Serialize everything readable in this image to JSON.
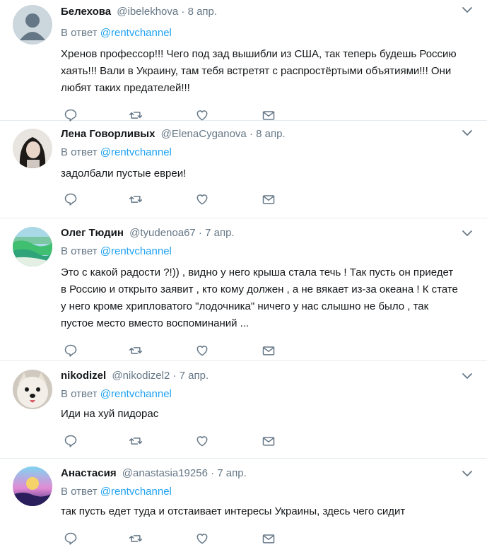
{
  "tweets": [
    {
      "name": "Белехова",
      "handle": "@ibelekhova",
      "time": "8 апр.",
      "reply_prefix": "В ответ ",
      "reply_mention": "@rentvchannel",
      "text": "Хренов профессор!!! Чего под зад вышибли из США, так теперь будешь Россию хаять!!! Вали в Украину, там тебя встретят с распростёртыми объятиями!!! Они любят таких предателей!!!",
      "avatar": "default-avatar"
    },
    {
      "name": "Лена Говорливых",
      "handle": "@ElenaCyganova",
      "time": "8 апр.",
      "reply_prefix": "В ответ ",
      "reply_mention": "@rentvchannel",
      "text": "задолбали пустые евреи!",
      "avatar": "woman-photo-avatar"
    },
    {
      "name": "Олег Тюдин",
      "handle": "@tyudenoa67",
      "time": "7 апр.",
      "reply_prefix": "В ответ ",
      "reply_mention": "@rentvchannel",
      "text": "Это с какой радости ?!)) , видно у него крыша стала течь ! Так пусть он приедет в Россию и открыто заявит , кто кому должен , а не вякает из-за океана ! К стате у него кроме хрипловатого \"лодочника\" ничего у нас слышно не было , так пустое место вместо воспоминаний ...",
      "avatar": "sea-wave-avatar"
    },
    {
      "name": "nikodizel",
      "handle": "@nikodizel2",
      "time": "7 апр.",
      "reply_prefix": "В ответ ",
      "reply_mention": "@rentvchannel",
      "text": "Иди на хуй пидорас",
      "avatar": "dog-avatar"
    },
    {
      "name": "Анастасия",
      "handle": "@anastasia19256",
      "time": "7 апр.",
      "reply_prefix": "В ответ ",
      "reply_mention": "@rentvchannel",
      "text": "так пусть едет туда и отстаивает интересы Украины, здесь чего сидит",
      "avatar": "sunset-avatar"
    }
  ],
  "separator": " · ",
  "colors": {
    "text": "#14171a",
    "secondary": "#657786",
    "link": "#1da1f2",
    "border": "#e6ecf0",
    "icon": "#657786"
  }
}
